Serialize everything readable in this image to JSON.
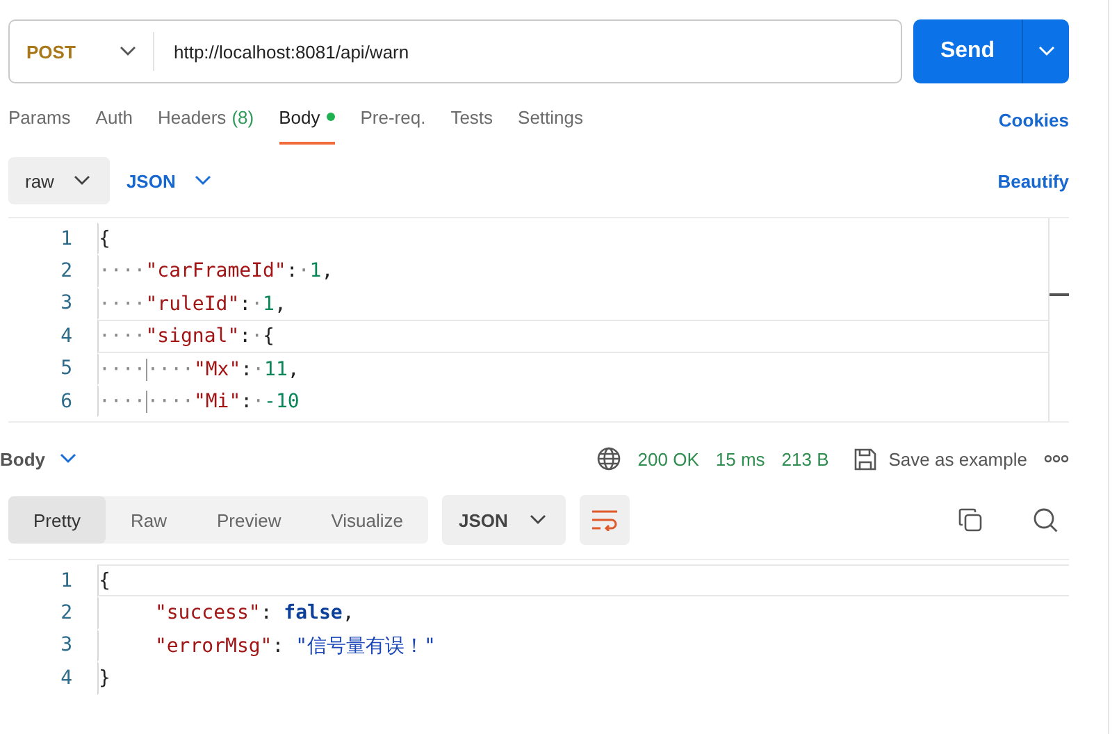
{
  "request": {
    "method": "POST",
    "url": "http://localhost:8081/api/warn",
    "send": "Send"
  },
  "tabs": [
    {
      "label": "Params",
      "selected": false
    },
    {
      "label": "Auth",
      "selected": false
    },
    {
      "label": "Headers",
      "count": "(8)",
      "selected": false
    },
    {
      "label": "Body",
      "selected": true,
      "dot": true
    },
    {
      "label": "Pre-req.",
      "selected": false
    },
    {
      "label": "Tests",
      "selected": false
    },
    {
      "label": "Settings",
      "selected": false
    }
  ],
  "cookies": "Cookies",
  "body_options": {
    "mode": "raw",
    "language": "JSON",
    "beautify": "Beautify"
  },
  "request_body": [
    {
      "number": "1",
      "tokens": [
        {
          "kind": "punct",
          "text": "{"
        }
      ]
    },
    {
      "number": "2",
      "indent": "····",
      "tokens": [
        {
          "kind": "key",
          "text": "\"carFrameId\""
        },
        {
          "kind": "punct",
          "text": ":"
        },
        {
          "kind": "ws",
          "text": "·"
        },
        {
          "kind": "number",
          "text": "1"
        },
        {
          "kind": "punct",
          "text": ","
        }
      ]
    },
    {
      "number": "3",
      "indent": "····",
      "tokens": [
        {
          "kind": "key",
          "text": "\"ruleId\""
        },
        {
          "kind": "punct",
          "text": ":"
        },
        {
          "kind": "ws",
          "text": "·"
        },
        {
          "kind": "number",
          "text": "1"
        },
        {
          "kind": "punct",
          "text": ","
        }
      ]
    },
    {
      "number": "4",
      "indent": "····",
      "current": true,
      "tokens": [
        {
          "kind": "key",
          "text": "\"signal\""
        },
        {
          "kind": "punct",
          "text": ":"
        },
        {
          "kind": "ws",
          "text": "·"
        },
        {
          "kind": "punct",
          "text": "{"
        }
      ]
    },
    {
      "number": "5",
      "indent": "····",
      "indent2": "····",
      "tokens": [
        {
          "kind": "key",
          "text": "\"Mx\""
        },
        {
          "kind": "punct",
          "text": ":"
        },
        {
          "kind": "ws",
          "text": "·"
        },
        {
          "kind": "number",
          "text": "11"
        },
        {
          "kind": "punct",
          "text": ","
        }
      ]
    },
    {
      "number": "6",
      "indent": "····",
      "indent2": "····",
      "tokens": [
        {
          "kind": "key",
          "text": "\"Mi\""
        },
        {
          "kind": "punct",
          "text": ":"
        },
        {
          "kind": "ws",
          "text": "·"
        },
        {
          "kind": "number",
          "text": "-10"
        }
      ]
    }
  ],
  "response": {
    "label": "Body",
    "status": "200 OK",
    "time": "15 ms",
    "size": "213 B",
    "save": "Save as example",
    "views": [
      {
        "label": "Pretty",
        "selected": true
      },
      {
        "label": "Raw",
        "selected": false
      },
      {
        "label": "Preview",
        "selected": false
      },
      {
        "label": "Visualize",
        "selected": false
      }
    ],
    "format": "JSON",
    "lines": [
      {
        "number": "1",
        "current": true,
        "indented": false,
        "tokens": [
          {
            "kind": "punct",
            "text": "{"
          }
        ]
      },
      {
        "number": "2",
        "current": false,
        "indented": true,
        "tokens": [
          {
            "kind": "key",
            "text": "\"success\""
          },
          {
            "kind": "punct",
            "text": ": "
          },
          {
            "kind": "keyword",
            "text": "false"
          },
          {
            "kind": "punct",
            "text": ","
          }
        ]
      },
      {
        "number": "3",
        "current": false,
        "indented": true,
        "tokens": [
          {
            "kind": "key",
            "text": "\"errorMsg\""
          },
          {
            "kind": "punct",
            "text": ": "
          },
          {
            "kind": "string",
            "text": "\"信号量有误！\""
          }
        ]
      },
      {
        "number": "4",
        "current": false,
        "indented": false,
        "tokens": [
          {
            "kind": "punct",
            "text": "}"
          }
        ]
      }
    ]
  }
}
